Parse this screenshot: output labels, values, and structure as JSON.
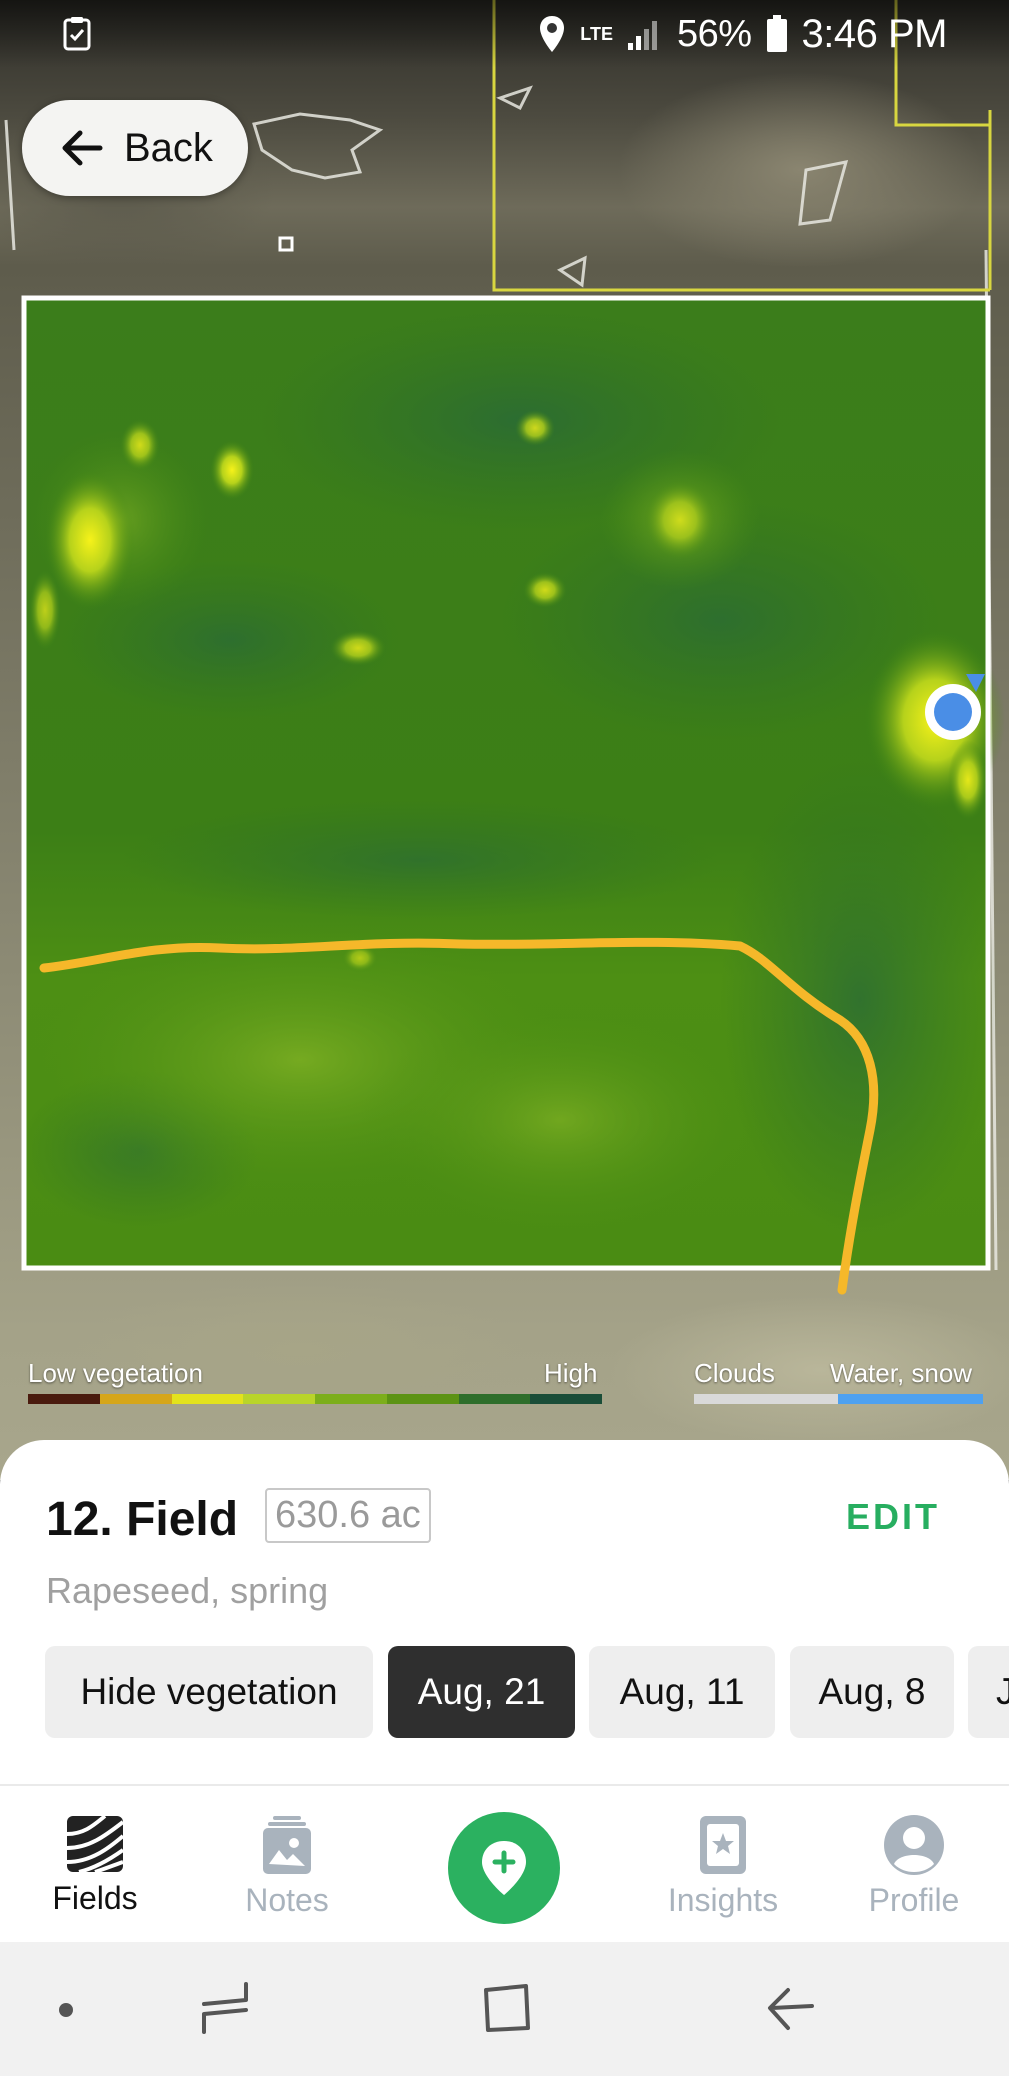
{
  "status_bar": {
    "network": "LTE",
    "battery_percent": "56%",
    "time": "3:46 PM"
  },
  "back_button": {
    "label": "Back"
  },
  "legend": {
    "low_label": "Low vegetation",
    "high_label": "High",
    "clouds_label": "Clouds",
    "water_label": "Water, snow",
    "vegetation_scale_colors": [
      "#4a1b0e",
      "#d6a61a",
      "#e3e21d",
      "#b9d42a",
      "#7cae1b",
      "#5c9314",
      "#2e6e2b",
      "#1a4d38"
    ],
    "clouds_color": "#d9d9d9",
    "water_color": "#4ea1f0"
  },
  "field": {
    "title": "12. Field",
    "area": "630.6 ac",
    "edit_label": "EDIT",
    "crop": "Rapeseed, spring"
  },
  "chips": [
    {
      "label": "Hide vegetation",
      "active": false
    },
    {
      "label": "Aug, 21",
      "active": true
    },
    {
      "label": "Aug, 11",
      "active": false
    },
    {
      "label": "Aug, 8",
      "active": false
    },
    {
      "label": "J",
      "active": false
    }
  ],
  "nav": {
    "fields": "Fields",
    "notes": "Notes",
    "insights": "Insights",
    "profile": "Profile"
  },
  "colors": {
    "accent_green": "#2bb160",
    "edit_green": "#27ae60",
    "track_yellow": "#f5b82a",
    "location_blue": "#4a8ee6"
  }
}
